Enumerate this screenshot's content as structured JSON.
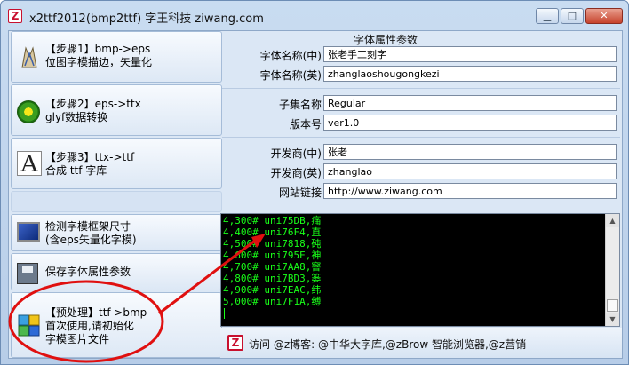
{
  "window": {
    "title": "x2ttf2012(bmp2ttf) 字王科技 ziwang.com",
    "icon": "z-logo-icon",
    "controls": [
      "minimize-icon",
      "maximize-icon",
      "close-icon"
    ],
    "accent_color": "#c8102e"
  },
  "left_buttons": [
    {
      "id": "step1",
      "line1": "【步骤1】bmp->eps",
      "line2": "位图字模描边，矢量化",
      "icon": "pen-nib-icon"
    },
    {
      "id": "step2",
      "line1": "【步骤2】eps->ttx",
      "line2": "glyf数据转换",
      "icon": "flower-icon"
    },
    {
      "id": "step3",
      "line1": "【步骤3】ttx->ttf",
      "line2": "合成 ttf 字库",
      "icon": "font-file-icon"
    },
    {
      "id": "detect",
      "line1": "检测字模框架尺寸",
      "line2": "(含eps矢量化字模)",
      "icon": "monitor-icon"
    },
    {
      "id": "save",
      "line1": "保存字体属性参数",
      "line2": "",
      "icon": "floppy-disk-icon"
    },
    {
      "id": "preprocess",
      "line1": "【预处理】ttf->bmp",
      "line2": "首次使用,请初始化",
      "line3": "字模图片文件",
      "icon": "cubes-icon"
    }
  ],
  "properties": {
    "section_title": "字体属性参数",
    "fields": [
      {
        "label": "字体名称(中)",
        "value": "张老手工刻字"
      },
      {
        "label": "字体名称(英)",
        "value": "zhanglaoshougongkezi"
      },
      {
        "label": "子集名称",
        "value": "Regular"
      },
      {
        "label": "版本号",
        "value": "ver1.0"
      },
      {
        "label": "开发商(中)",
        "value": "张老"
      },
      {
        "label": "开发商(英)",
        "value": "zhanglao"
      },
      {
        "label": "网站链接",
        "value": "http://www.ziwang.com"
      }
    ]
  },
  "console": {
    "lines": [
      "4,300# uni75DB,痛",
      "4,400# uni76F4,直",
      "4,500# uni7818,砘",
      "4,600# uni795E,神",
      "4,700# uni7AA8,窨",
      "4,800# uni7BD3,篓",
      "4,900# uni7EAC,纬",
      "5,000# uni7F1A,缚"
    ],
    "text_color": "#19ff19"
  },
  "footer": {
    "text": "访问 @z博客: @中华大字库,@zBrow 智能浏览器,@z营销",
    "icon": "z-logo-icon"
  },
  "annotation": {
    "color": "#e01010"
  }
}
